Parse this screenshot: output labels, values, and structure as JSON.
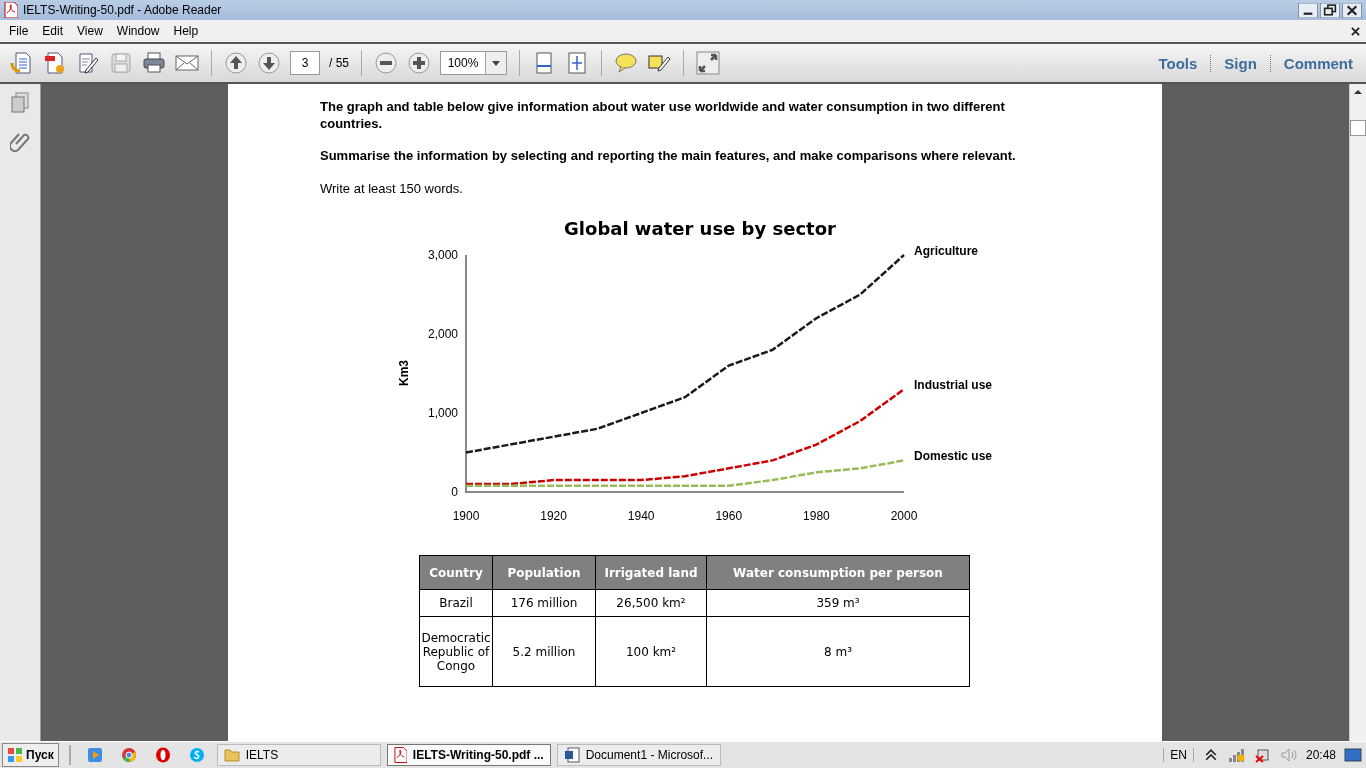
{
  "window": {
    "title": "IELTS-Writing-50.pdf - Adobe Reader"
  },
  "menu": [
    "File",
    "Edit",
    "View",
    "Window",
    "Help"
  ],
  "toolbar": {
    "page": "3",
    "page_count": "/ 55",
    "zoom": "100%",
    "links": [
      "Tools",
      "Sign",
      "Comment"
    ]
  },
  "document": {
    "paragraphs": [
      {
        "text": "The graph and table below give information about water use worldwide and water consumption in two different countries.",
        "bold": true
      },
      {
        "text": "Summarise the information by selecting and reporting the main features, and make comparisons where relevant.",
        "bold": true
      },
      {
        "text": "Write at least 150 words.",
        "bold": false
      }
    ],
    "chart_data": {
      "type": "line",
      "title": "Global water use by sector",
      "ylabel": "Km3",
      "x": [
        1900,
        1910,
        1920,
        1930,
        1940,
        1950,
        1960,
        1970,
        1980,
        1990,
        2000
      ],
      "series": [
        {
          "name": "Agriculture",
          "color": "#1a1a1a",
          "line_style": "dashed",
          "values": [
            500,
            600,
            700,
            800,
            1000,
            1200,
            1600,
            1800,
            2200,
            2500,
            3000
          ]
        },
        {
          "name": "Industrial use",
          "color": "#cc0000",
          "line_style": "dashed",
          "values": [
            100,
            100,
            150,
            150,
            150,
            200,
            300,
            400,
            600,
            900,
            1300
          ]
        },
        {
          "name": "Domestic use",
          "color": "#9bbb59",
          "line_style": "dashed",
          "values": [
            80,
            80,
            80,
            80,
            80,
            80,
            80,
            150,
            250,
            300,
            400
          ]
        }
      ],
      "xlim": [
        1900,
        2000
      ],
      "ylim": [
        0,
        3000
      ],
      "xticks": [
        1900,
        1920,
        1940,
        1960,
        1980,
        2000
      ],
      "yticks": [
        {
          "value": 0,
          "label": "0"
        },
        {
          "value": 1000,
          "label": "1,000"
        },
        {
          "value": 2000,
          "label": "2,000"
        },
        {
          "value": 3000,
          "label": "3,000"
        }
      ]
    },
    "table": {
      "columns": [
        "Country",
        "Population",
        "Irrigated land",
        "Water consumption per person"
      ],
      "rows": [
        [
          "Brazil",
          "176 million",
          "26,500 km²",
          "359 m³"
        ],
        [
          "Democratic Republic of Congo",
          "5.2 million",
          "100 km²",
          "8 m³"
        ]
      ]
    }
  },
  "taskbar": {
    "start": "Пуск",
    "tasks": [
      {
        "kind": "folder",
        "label": "IELTS",
        "selected": false
      },
      {
        "kind": "pdf",
        "label": "IELTS-Writing-50.pdf ...",
        "selected": true
      },
      {
        "kind": "word",
        "label": "Document1 - Microsof...",
        "selected": false
      }
    ],
    "language": "EN",
    "clock": "20:48"
  }
}
